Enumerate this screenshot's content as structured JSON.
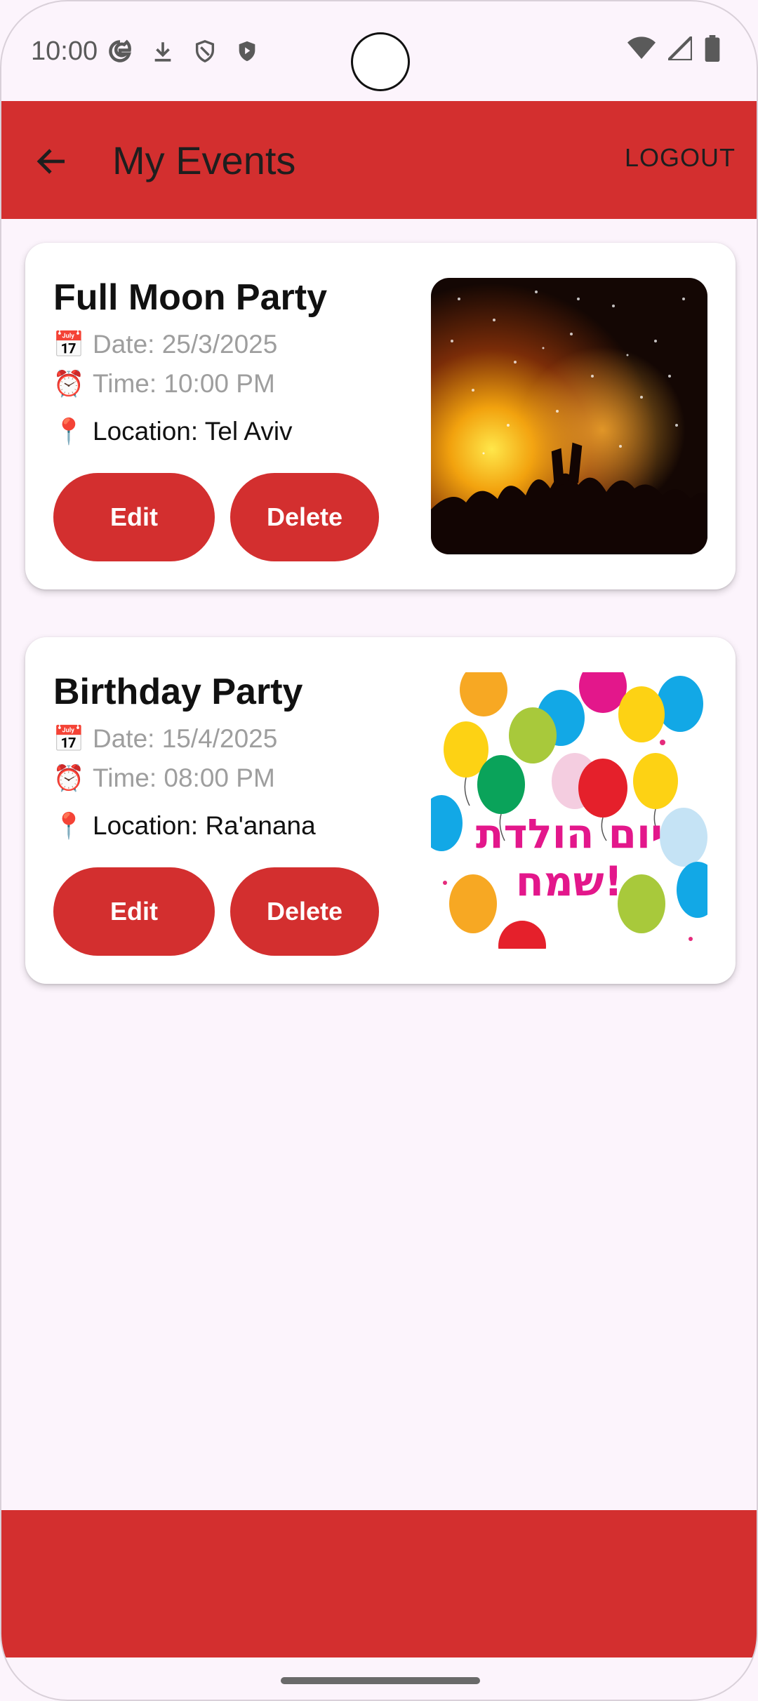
{
  "status_bar": {
    "time": "10:00",
    "icons_left": [
      "google-icon",
      "download-icon",
      "shield-outline-icon",
      "shield-play-icon"
    ],
    "icons_right": [
      "wifi-icon",
      "signal-icon",
      "battery-icon"
    ]
  },
  "app_bar": {
    "title": "My Events",
    "logout_label": "LOGOUT",
    "color": "#d32f2f"
  },
  "events": [
    {
      "title": "Full Moon Party",
      "date": "Date: 25/3/2025",
      "time": "Time: 10:00 PM",
      "location": "Location: Tel Aviv",
      "edit_label": "Edit",
      "delete_label": "Delete"
    },
    {
      "title": "Birthday Party",
      "date": "Date: 15/4/2025",
      "time": "Time: 08:00 PM",
      "location": "Location: Ra'anana",
      "edit_label": "Edit",
      "delete_label": "Delete",
      "image_text_line1": "יום הולדת",
      "image_text_line2": "שמח!"
    }
  ]
}
